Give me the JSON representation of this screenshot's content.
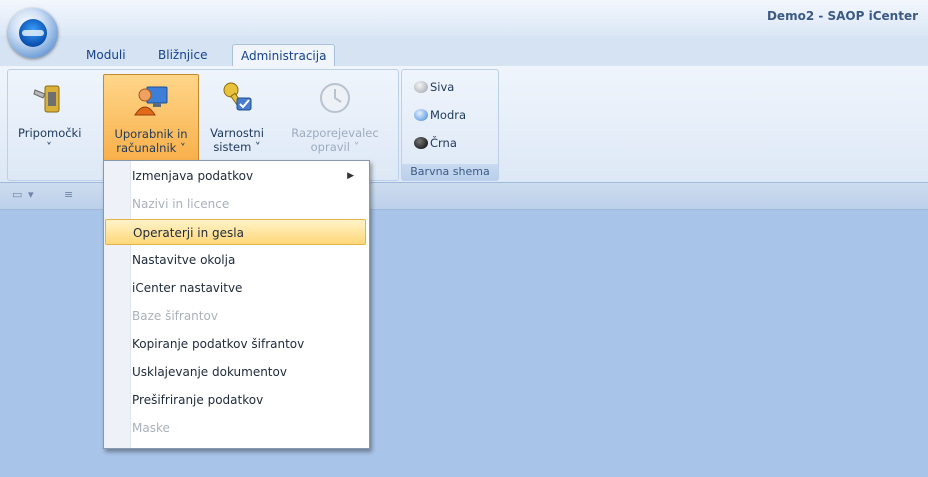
{
  "window": {
    "title": "Demo2 - SAOP iCenter"
  },
  "tabs": [
    {
      "label": "Moduli"
    },
    {
      "label": "Bližnjice"
    },
    {
      "label": "Administracija",
      "active": true
    }
  ],
  "ribbon": {
    "buttons": [
      {
        "label_line1": "Pripomočki",
        "label_line2": "˅",
        "icon": "tools-icon"
      },
      {
        "label_line1": "Uporabnik in",
        "label_line2": "računalnik ˅",
        "icon": "user-computer-icon",
        "selected": true
      },
      {
        "label_line1": "Varnostni",
        "label_line2": "sistem ˅",
        "icon": "security-key-icon"
      },
      {
        "label_line1": "Razporejevalec",
        "label_line2": "opravil ˅",
        "icon": "scheduler-clock-icon",
        "disabled": true
      }
    ],
    "color_scheme": {
      "group_label": "Barvna shema",
      "options": [
        {
          "label": "Siva",
          "color": "#b8bcc4"
        },
        {
          "label": "Modra",
          "color": "#5c9ce6"
        },
        {
          "label": "Črna",
          "color": "#1a1a1a"
        }
      ]
    }
  },
  "dropdown_menu": {
    "items": [
      {
        "label": "Izmenjava podatkov",
        "has_submenu": true
      },
      {
        "label": "Nazivi in licence",
        "disabled": true
      },
      {
        "label": "Operaterji in gesla",
        "highlighted": true
      },
      {
        "label": "Nastavitve okolja"
      },
      {
        "label": "iCenter nastavitve"
      },
      {
        "label": "Baze šifrantov",
        "disabled": true
      },
      {
        "label": "Kopiranje podatkov šifrantov"
      },
      {
        "label": "Usklajevanje dokumentov"
      },
      {
        "label": "Prešifriranje podatkov"
      },
      {
        "label": "Maske",
        "disabled": true
      }
    ]
  },
  "colors": {
    "accent": "#f8b04a",
    "background": "#a9c4e9"
  }
}
